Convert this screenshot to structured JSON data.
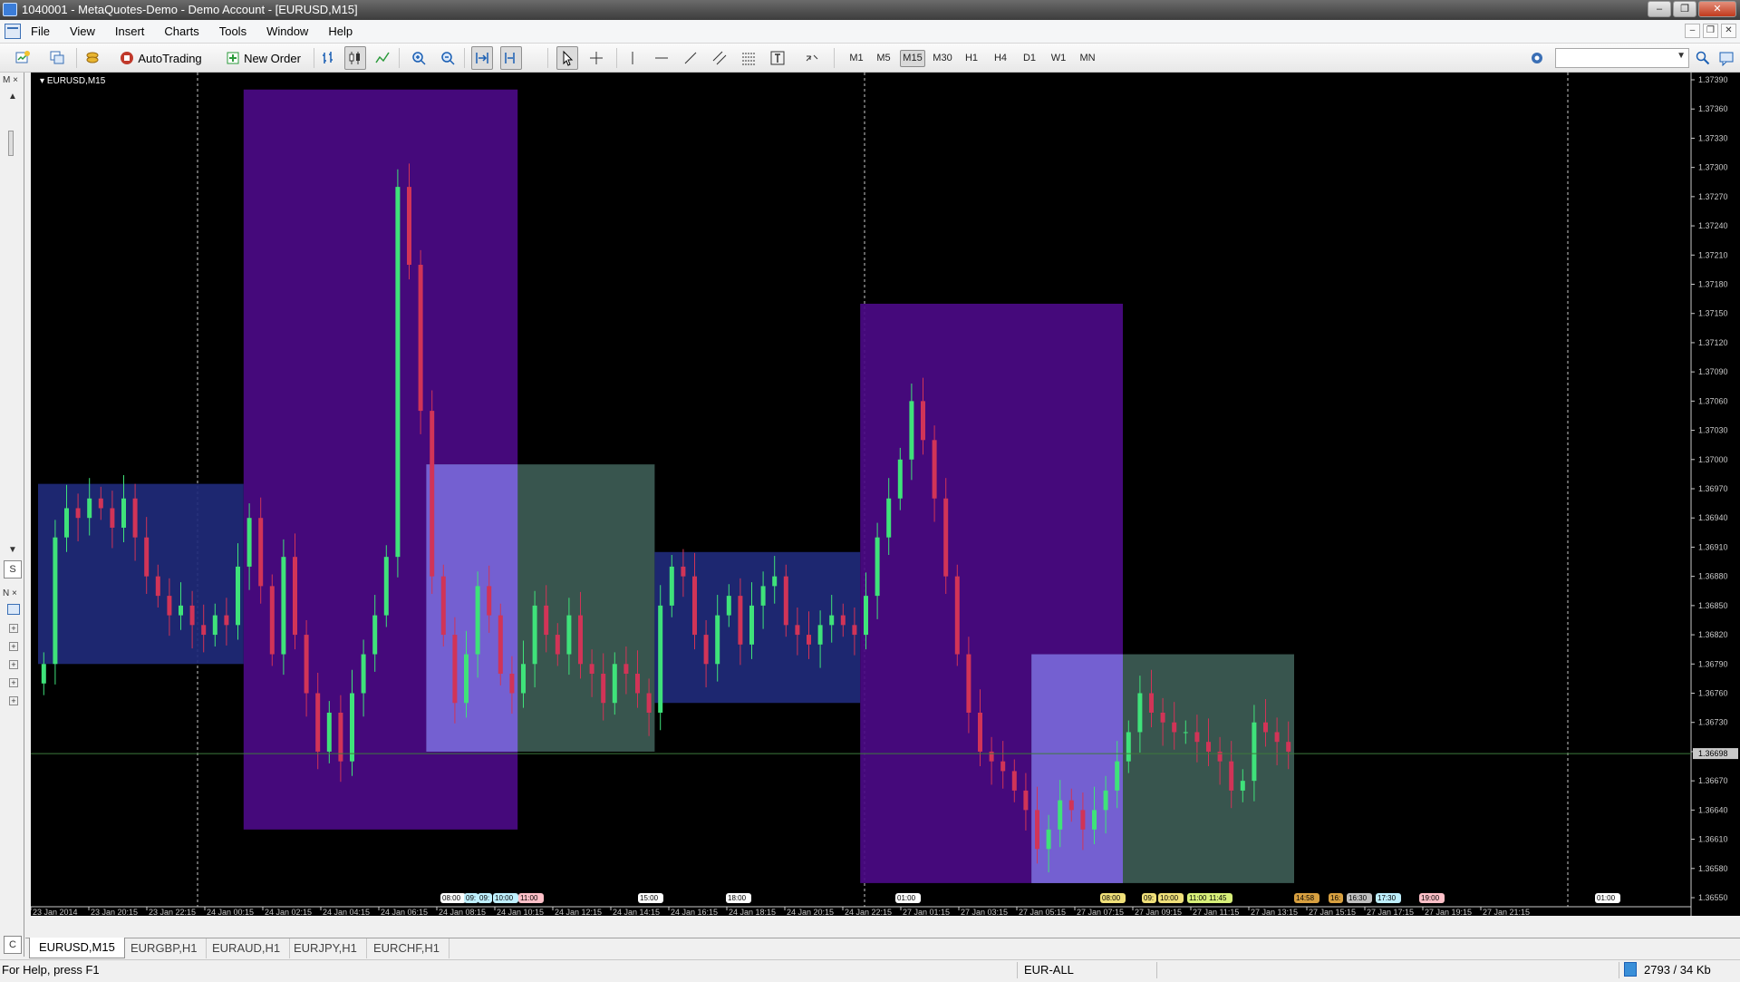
{
  "window": {
    "title": "1040001 - MetaQuotes-Demo - Demo Account - [EURUSD,M15]",
    "buttons": [
      "minimize",
      "restore",
      "close"
    ]
  },
  "menu": [
    "File",
    "View",
    "Insert",
    "Charts",
    "Tools",
    "Window",
    "Help"
  ],
  "toolbar": {
    "autotrading_label": "AutoTrading",
    "new_order_label": "New Order",
    "timeframes": [
      "M1",
      "M5",
      "M15",
      "M30",
      "H1",
      "H4",
      "D1",
      "W1",
      "MN"
    ],
    "active_timeframe": "M15",
    "search_value": ""
  },
  "side_panel": {
    "market_watch_marker": "M",
    "navigator_marker": "N",
    "tab_marker": "S",
    "bottom_marker": "C"
  },
  "chart": {
    "label": "EURUSD,M15",
    "current_price": "1.36698",
    "colors": {
      "background": "#000000",
      "bull": "#3fe27a",
      "bear": "#d13457",
      "asia_box": "#1f2a7a",
      "london_box": "#4b0a85",
      "ny_box": "#3d5c55",
      "overlap_box": "#7e63e6",
      "price_line": "#3d7a3d"
    }
  },
  "chart_data": {
    "type": "candlestick",
    "symbol": "EURUSD",
    "timeframe": "M15",
    "y_ticks": [
      "1.37390",
      "1.37360",
      "1.37330",
      "1.37300",
      "1.37270",
      "1.37240",
      "1.37210",
      "1.37180",
      "1.37150",
      "1.37120",
      "1.37090",
      "1.37060",
      "1.37030",
      "1.37000",
      "1.36970",
      "1.36940",
      "1.36910",
      "1.36880",
      "1.36850",
      "1.36820",
      "1.36790",
      "1.36760",
      "1.36730",
      "1.36700",
      "1.36670",
      "1.36640",
      "1.36610",
      "1.36580",
      "1.36550"
    ],
    "ylim": [
      1.3655,
      1.3739
    ],
    "x_ticks": [
      "23 Jan 2014",
      "23 Jan 20:15",
      "23 Jan 22:15",
      "24 Jan 00:15",
      "24 Jan 02:15",
      "24 Jan 04:15",
      "24 Jan 06:15",
      "24 Jan 08:15",
      "24 Jan 10:15",
      "24 Jan 12:15",
      "24 Jan 14:15",
      "24 Jan 16:15",
      "24 Jan 18:15",
      "24 Jan 20:15",
      "24 Jan 22:15",
      "27 Jan 01:15",
      "27 Jan 03:15",
      "27 Jan 05:15",
      "27 Jan 07:15",
      "27 Jan 09:15",
      "27 Jan 11:15",
      "27 Jan 13:15",
      "27 Jan 15:15",
      "27 Jan 17:15",
      "27 Jan 19:15",
      "27 Jan 21:15"
    ],
    "session_time_labels": [
      "08:00",
      "09:",
      "09:",
      "10:00",
      "11:00",
      "15:00",
      "18:00",
      "01:00",
      "08:00",
      "09:",
      "10:00",
      "11:00",
      "11:45",
      "14:58",
      "16:",
      "16:30",
      "17:30",
      "19:00",
      "01:00"
    ],
    "sessions": [
      {
        "type": "asia",
        "start_index": 0,
        "end_index": 18,
        "high": 1.36975,
        "low": 1.3679
      },
      {
        "type": "london",
        "start_index": 18,
        "end_index": 42,
        "high": 1.3738,
        "low": 1.3662
      },
      {
        "type": "newyork",
        "start_index": 34,
        "end_index": 54,
        "high": 1.36995,
        "low": 1.367
      },
      {
        "type": "asia",
        "start_index": 54,
        "end_index": 72,
        "high": 1.36905,
        "low": 1.3675
      },
      {
        "type": "london",
        "start_index": 72,
        "end_index": 95,
        "high": 1.3716,
        "low": 1.36565
      },
      {
        "type": "newyork",
        "start_index": 87,
        "end_index": 110,
        "high": 1.368,
        "low": 1.36565
      }
    ],
    "candles_close": [
      1.3679,
      1.3692,
      1.3695,
      1.3694,
      1.3696,
      1.3695,
      1.3693,
      1.3696,
      1.3692,
      1.3688,
      1.3686,
      1.3684,
      1.3685,
      1.3683,
      1.3682,
      1.3684,
      1.3683,
      1.3689,
      1.3694,
      1.3687,
      1.368,
      1.369,
      1.3682,
      1.3676,
      1.367,
      1.3674,
      1.3669,
      1.3676,
      1.368,
      1.3684,
      1.369,
      1.3728,
      1.372,
      1.3705,
      1.3688,
      1.3682,
      1.3675,
      1.368,
      1.3687,
      1.3684,
      1.3678,
      1.3676,
      1.3679,
      1.3685,
      1.3682,
      1.368,
      1.3684,
      1.3679,
      1.3678,
      1.3675,
      1.3679,
      1.3678,
      1.3676,
      1.3674,
      1.3685,
      1.3689,
      1.3688,
      1.3682,
      1.3679,
      1.3684,
      1.3686,
      1.3681,
      1.3685,
      1.3687,
      1.3688,
      1.3683,
      1.3682,
      1.3681,
      1.3683,
      1.3684,
      1.3683,
      1.3682,
      1.3686,
      1.3692,
      1.3696,
      1.37,
      1.3706,
      1.3702,
      1.3696,
      1.3688,
      1.368,
      1.3674,
      1.367,
      1.3669,
      1.3668,
      1.3666,
      1.3664,
      1.366,
      1.3662,
      1.3665,
      1.3664,
      1.3662,
      1.3664,
      1.3666,
      1.3669,
      1.3672,
      1.3676,
      1.3674,
      1.3673,
      1.3672,
      1.3672,
      1.3671,
      1.367,
      1.3669,
      1.3666,
      1.3667,
      1.3673,
      1.3672,
      1.3671,
      1.367
    ]
  },
  "tabs": [
    "EURUSD,M15",
    "EURGBP,H1",
    "EURAUD,H1",
    "EURJPY,H1",
    "EURCHF,H1"
  ],
  "active_tab": "EURUSD,M15",
  "status": {
    "help": "For Help, press F1",
    "profile": "EUR-ALL",
    "traffic": "2793 / 34 Kb"
  }
}
